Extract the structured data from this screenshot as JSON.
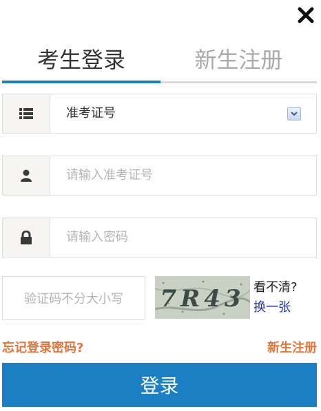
{
  "tabs": {
    "login": "考生登录",
    "register": "新生注册"
  },
  "form": {
    "id_type_value": "准考证号",
    "id_number_placeholder": "请输入准考证号",
    "password_placeholder": "请输入密码",
    "captcha_placeholder": "验证码不分大小写",
    "captcha_text": "7R43",
    "captcha_unclear": "看不清?",
    "captcha_refresh": "换一张"
  },
  "links": {
    "forgot_password": "忘记登录密码?",
    "new_register": "新生注册"
  },
  "buttons": {
    "login": "登录"
  },
  "colors": {
    "accent": "#1b7fc4",
    "link_orange": "#e4743a",
    "refresh_blue": "#1a2fbf"
  }
}
